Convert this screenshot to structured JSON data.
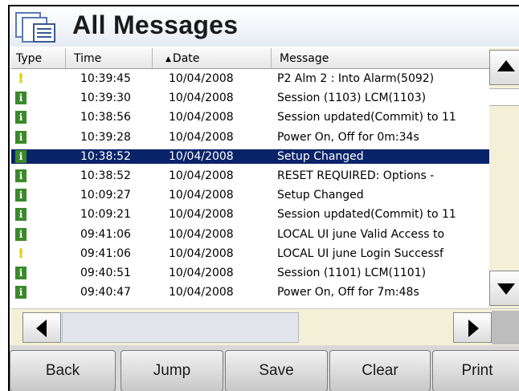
{
  "window": {
    "title": "All Messages"
  },
  "columns": {
    "type": "Type",
    "time": "Time",
    "date": "Date",
    "message": "Message",
    "sort_indicator": "▲"
  },
  "rows": [
    {
      "icon": "warning",
      "time": "10:39:45",
      "date": "10/04/2008",
      "message": "P2 Alm 2 : Into Alarm(5092)",
      "selected": false
    },
    {
      "icon": "info",
      "time": "10:39:30",
      "date": "10/04/2008",
      "message": "Session (1103) LCM(1103)",
      "selected": false
    },
    {
      "icon": "info",
      "time": "10:38:56",
      "date": "10/04/2008",
      "message": "Session updated(Commit) to 11",
      "selected": false
    },
    {
      "icon": "info",
      "time": "10:39:28",
      "date": "10/04/2008",
      "message": "Power On, Off for 0m:34s",
      "selected": false
    },
    {
      "icon": "info",
      "time": "10:38:52",
      "date": "10/04/2008",
      "message": "Setup Changed",
      "selected": true
    },
    {
      "icon": "info",
      "time": "10:38:52",
      "date": "10/04/2008",
      "message": "RESET REQUIRED: Options -",
      "selected": false
    },
    {
      "icon": "info",
      "time": "10:09:27",
      "date": "10/04/2008",
      "message": "Setup Changed",
      "selected": false
    },
    {
      "icon": "info",
      "time": "10:09:21",
      "date": "10/04/2008",
      "message": "Session updated(Commit) to 11",
      "selected": false
    },
    {
      "icon": "info",
      "time": "09:41:06",
      "date": "10/04/2008",
      "message": "LOCAL UI june Valid Access to",
      "selected": false
    },
    {
      "icon": "warning",
      "time": "09:41:06",
      "date": "10/04/2008",
      "message": "LOCAL UI june Login Successf",
      "selected": false
    },
    {
      "icon": "info",
      "time": "09:40:51",
      "date": "10/04/2008",
      "message": "Session (1101) LCM(1101)",
      "selected": false
    },
    {
      "icon": "info",
      "time": "09:40:47",
      "date": "10/04/2008",
      "message": "Power On, Off for 7m:48s",
      "selected": false
    }
  ],
  "buttons": {
    "back": "Back",
    "jump": "Jump",
    "save": "Save",
    "clear": "Clear",
    "print": "Print"
  },
  "icons": {
    "app": "message-list-icon",
    "info": "info-icon",
    "warning": "warning-icon",
    "scroll_up": "arrow-up-icon",
    "scroll_down": "arrow-down-icon",
    "scroll_left": "arrow-left-icon",
    "scroll_right": "arrow-right-icon"
  },
  "colors": {
    "selected_row": "#0a246a",
    "info_icon": "#3a8a2a",
    "warning_icon": "#e8d800",
    "scroll_track": "#f4f0d8"
  }
}
